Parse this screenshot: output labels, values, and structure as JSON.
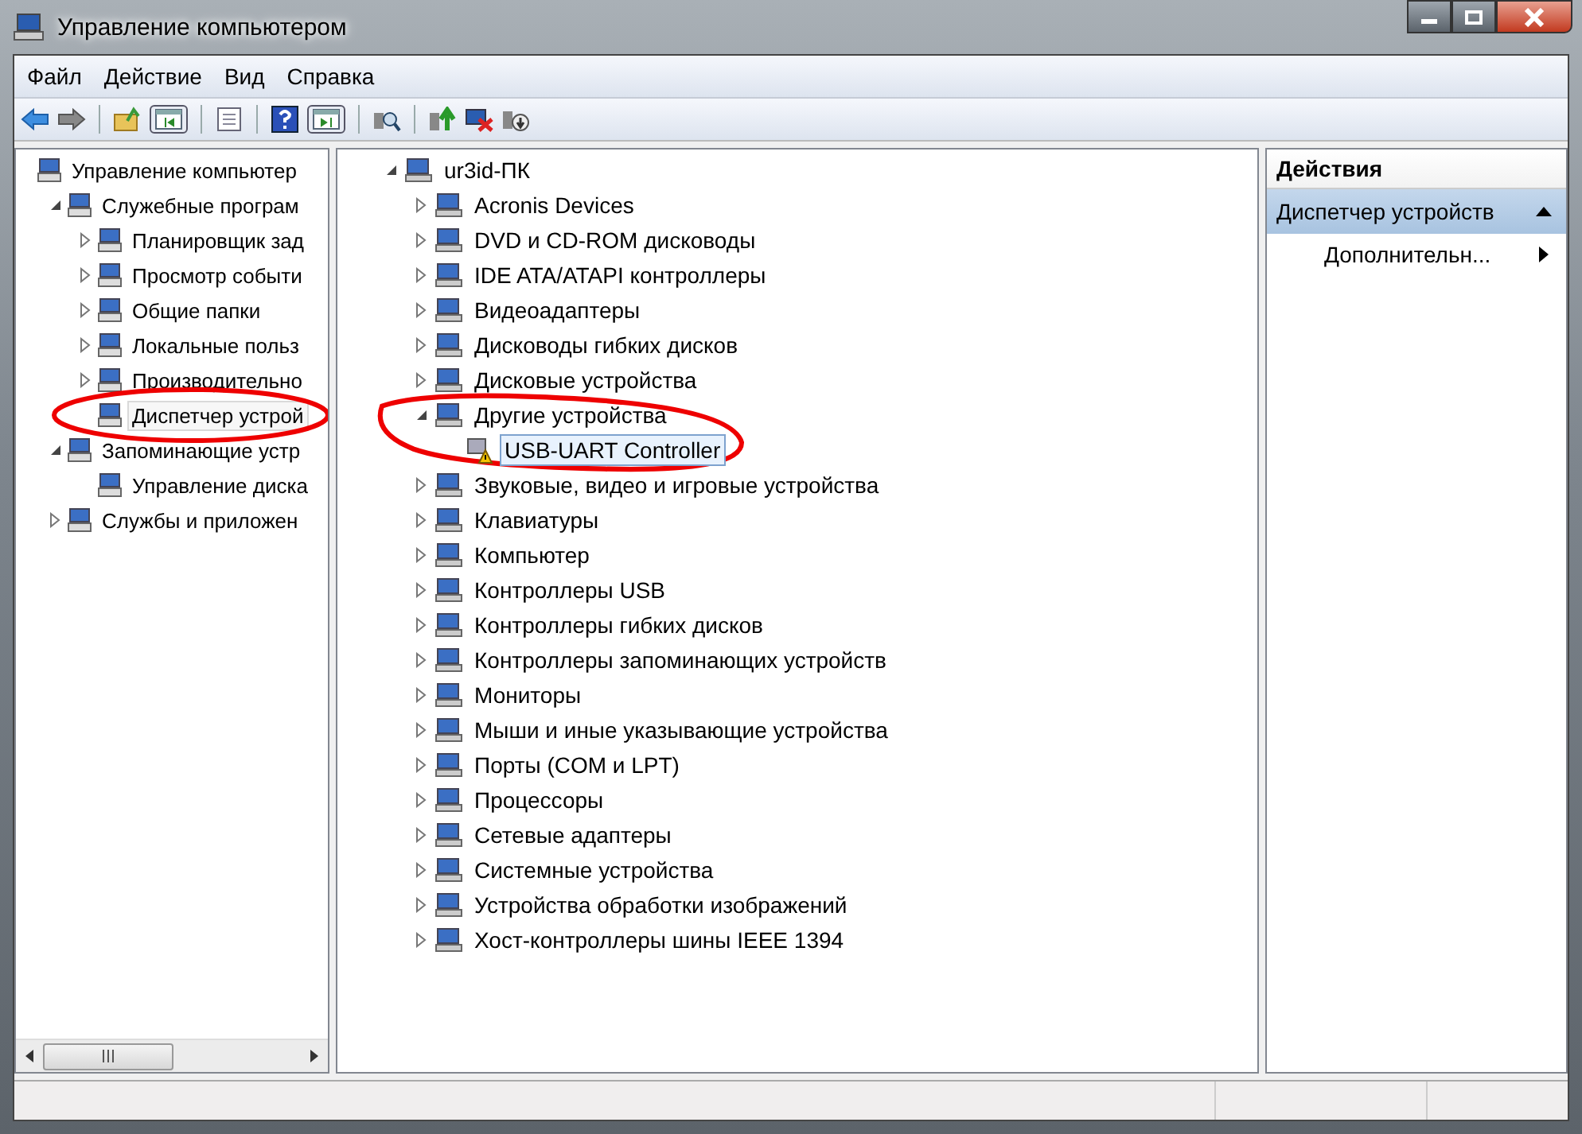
{
  "window": {
    "title": "Управление компьютером"
  },
  "menu": [
    "Файл",
    "Действие",
    "Вид",
    "Справка"
  ],
  "left_tree": [
    {
      "label": "Управление компьютер",
      "selected": false,
      "children": [
        {
          "label": "Служебные програм",
          "expanded": true,
          "selected": false,
          "children": [
            {
              "label": "Планировщик зад",
              "expanded": false,
              "selected": false
            },
            {
              "label": "Просмотр событи",
              "expanded": false,
              "selected": false
            },
            {
              "label": "Общие папки",
              "expanded": false,
              "selected": false
            },
            {
              "label": "Локальные польз",
              "expanded": false,
              "selected": false
            },
            {
              "label": "Производительно",
              "expanded": false,
              "selected": false
            },
            {
              "label": "Диспетчер устрой",
              "selected": true,
              "circled": true
            }
          ]
        },
        {
          "label": "Запоминающие устр",
          "expanded": true,
          "selected": false,
          "children": [
            {
              "label": "Управление диска",
              "selected": false
            }
          ]
        },
        {
          "label": "Службы и приложен",
          "expanded": false,
          "selected": false
        }
      ]
    }
  ],
  "device_tree": [
    {
      "label": "ur3id-ПК",
      "expanded": true,
      "selected": false,
      "children": [
        {
          "label": "Acronis Devices",
          "expanded": false,
          "selected": false
        },
        {
          "label": "DVD и CD-ROM дисководы",
          "expanded": false,
          "selected": false
        },
        {
          "label": "IDE ATA/ATAPI контроллеры",
          "expanded": false,
          "selected": false
        },
        {
          "label": "Видеоадаптеры",
          "expanded": false,
          "selected": false
        },
        {
          "label": "Дисководы гибких дисков",
          "expanded": false,
          "selected": false
        },
        {
          "label": "Дисковые устройства",
          "expanded": false,
          "selected": false
        },
        {
          "label": "Другие устройства",
          "expanded": true,
          "selected": false,
          "circled": true,
          "children": [
            {
              "label": "USB-UART Controller",
              "selected": true,
              "warning": true
            }
          ]
        },
        {
          "label": "Звуковые, видео и игровые устройства",
          "expanded": false,
          "selected": false
        },
        {
          "label": "Клавиатуры",
          "expanded": false,
          "selected": false
        },
        {
          "label": "Компьютер",
          "expanded": false,
          "selected": false
        },
        {
          "label": "Контроллеры USB",
          "expanded": false,
          "selected": false
        },
        {
          "label": "Контроллеры гибких дисков",
          "expanded": false,
          "selected": false
        },
        {
          "label": "Контроллеры запоминающих устройств",
          "expanded": false,
          "selected": false
        },
        {
          "label": "Мониторы",
          "expanded": false,
          "selected": false
        },
        {
          "label": "Мыши и иные указывающие устройства",
          "expanded": false,
          "selected": false
        },
        {
          "label": "Порты (COM и LPT)",
          "expanded": false,
          "selected": false
        },
        {
          "label": "Процессоры",
          "expanded": false,
          "selected": false
        },
        {
          "label": "Сетевые адаптеры",
          "expanded": false,
          "selected": false
        },
        {
          "label": "Системные устройства",
          "expanded": false,
          "selected": false
        },
        {
          "label": "Устройства обработки изображений",
          "expanded": false,
          "selected": false
        },
        {
          "label": "Хост-контроллеры шины IEEE 1394",
          "expanded": false,
          "selected": false
        }
      ]
    }
  ],
  "actions": {
    "title": "Действия",
    "section": {
      "label": "Диспетчер устройств",
      "expanded": true
    },
    "items": [
      "Дополнительн..."
    ]
  }
}
